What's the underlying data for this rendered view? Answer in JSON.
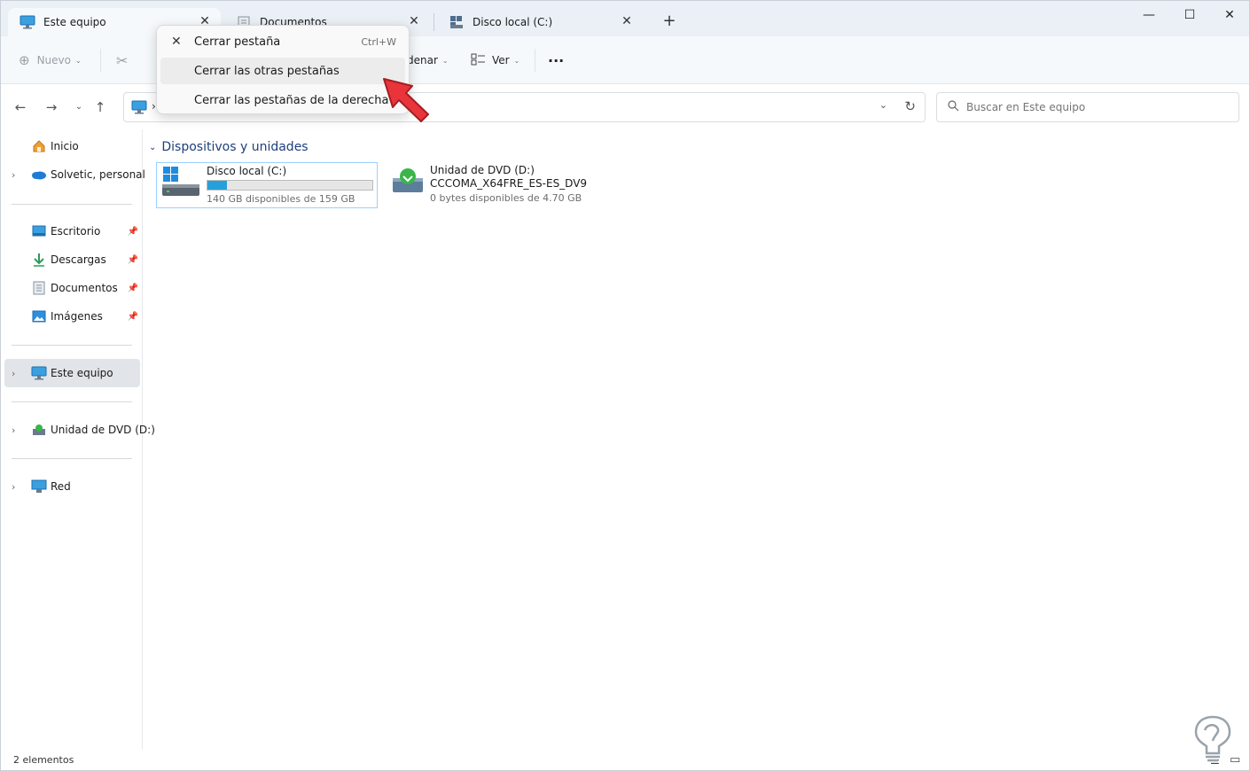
{
  "tabs": [
    {
      "label": "Este equipo",
      "active": true
    },
    {
      "label": "Documentos",
      "active": false
    },
    {
      "label": "Disco local (C:)",
      "active": false
    }
  ],
  "toolbar": {
    "new_label": "Nuevo",
    "sort_label": "denar",
    "view_label": "Ver",
    "more_label": "···"
  },
  "search": {
    "placeholder": "Buscar en Este equipo"
  },
  "address": {
    "separator": "›"
  },
  "sidebar": {
    "items": [
      {
        "label": "Inicio"
      },
      {
        "label": "Solvetic, personal"
      },
      {
        "label": "Escritorio"
      },
      {
        "label": "Descargas"
      },
      {
        "label": "Documentos"
      },
      {
        "label": "Imágenes"
      },
      {
        "label": "Este equipo"
      },
      {
        "label": "Unidad de DVD (D:)"
      },
      {
        "label": "Red"
      }
    ]
  },
  "content": {
    "group_title": "Dispositivos y unidades",
    "drives": [
      {
        "name": "Disco local (C:)",
        "free_text": "140 GB disponibles de 159 GB",
        "used_fraction": 0.12
      },
      {
        "name": "Unidad de DVD (D:)",
        "volume": "CCCOMA_X64FRE_ES-ES_DV9",
        "free_text": "0 bytes disponibles de 4.70 GB"
      }
    ]
  },
  "context_menu": {
    "items": [
      {
        "label": "Cerrar pestaña",
        "shortcut": "Ctrl+W"
      },
      {
        "label": "Cerrar las otras pestañas"
      },
      {
        "label": "Cerrar las pestañas de la derecha"
      }
    ]
  },
  "status": {
    "items_count": "2 elementos"
  },
  "colors": {
    "accent": "#0067c0",
    "drive_bar": "#26a0da",
    "arrow": "#e8343a"
  }
}
